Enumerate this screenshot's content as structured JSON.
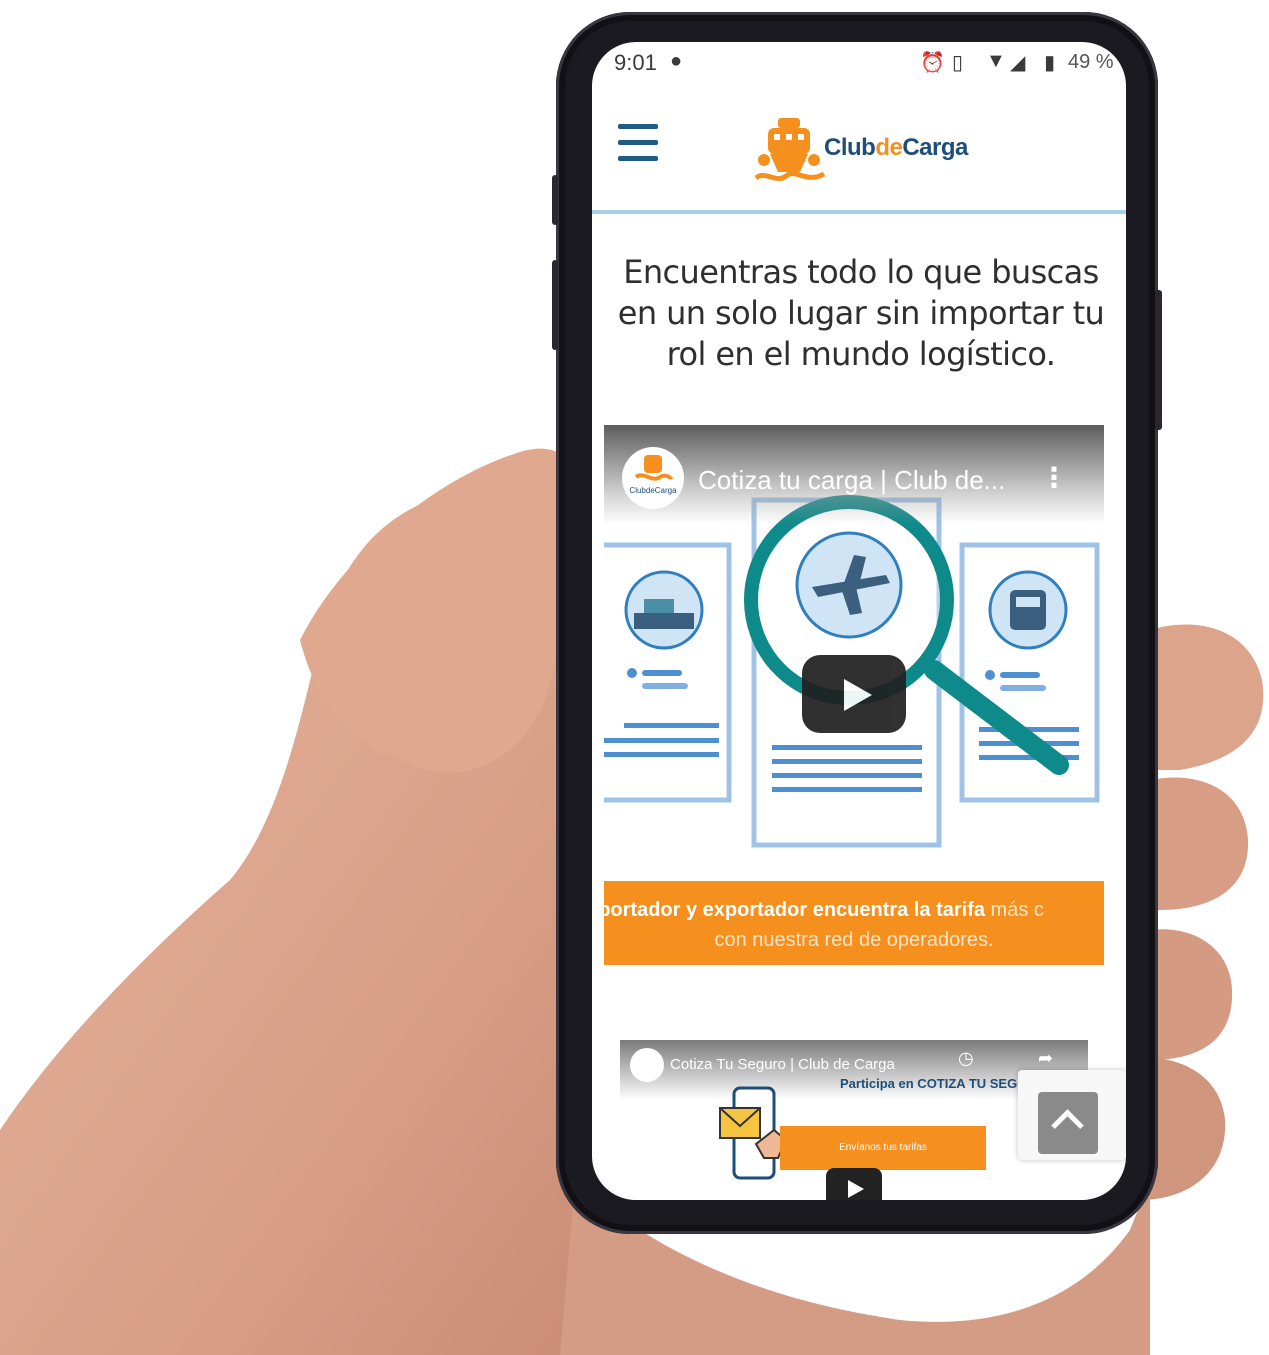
{
  "status_bar": {
    "time": "9:01",
    "battery": "49 %",
    "icons": [
      "alarm-icon",
      "vibrate-icon",
      "wifi-icon",
      "signal-icon",
      "battery-icon"
    ]
  },
  "header": {
    "menu_icon": "hamburger-menu-icon",
    "logo": {
      "club": "Club",
      "de": "de",
      "carga": "Carga"
    }
  },
  "headline": "Encuentras todo lo que buscas en un solo lugar sin importar tu rol en el mundo logístico.",
  "video_1": {
    "title": "Cotiza tu carga | Club de...",
    "banner_bold": "nportador y exportador encuentra la tarifa",
    "banner_light": " más c",
    "banner_line2": "con nuestra red de operadores."
  },
  "video_2": {
    "title": "Cotiza Tu Seguro | Club de Carga",
    "subtitle": "Participa en COTIZA TU SEG",
    "button": "Envíanos tus tarifas"
  },
  "colors": {
    "brand_orange": "#f5901f",
    "brand_blue": "#1d4e7a",
    "accent_teal": "#0f8a8a"
  }
}
